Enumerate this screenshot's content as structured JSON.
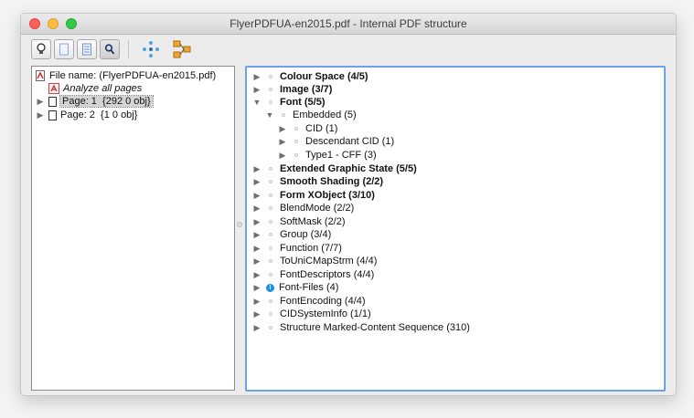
{
  "window": {
    "title": "FlyerPDFUA-en2015.pdf - Internal PDF structure"
  },
  "toolbar": {
    "buttons": [
      {
        "icon": "lightbulb-icon"
      },
      {
        "icon": "page-icon"
      },
      {
        "icon": "page-layout-icon"
      },
      {
        "icon": "magnifier-icon"
      },
      {
        "icon": "structure-nodes-icon"
      },
      {
        "icon": "tag-tree-icon"
      }
    ]
  },
  "left_tree": {
    "file_name": "File name: (FlyerPDFUA-en2015.pdf)",
    "analyze": "Analyze all pages",
    "pages": [
      {
        "label": "Page: 1",
        "obj": "{292 0 obj}"
      },
      {
        "label": "Page: 2",
        "obj": "{1 0 obj}"
      }
    ]
  },
  "right_tree": {
    "items": [
      {
        "label": "Colour Space (4/5)"
      },
      {
        "label": "Image (3/7)"
      },
      {
        "label": "Font (5/5)"
      },
      {
        "label": "Embedded (5)"
      },
      {
        "label": "CID (1)"
      },
      {
        "label": "Descendant CID (1)"
      },
      {
        "label": "Type1 - CFF (3)"
      },
      {
        "label": "Extended Graphic State (5/5)"
      },
      {
        "label": "Smooth Shading (2/2)"
      },
      {
        "label": "Form XObject (3/10)"
      },
      {
        "label": "BlendMode (2/2)"
      },
      {
        "label": "SoftMask (2/2)"
      },
      {
        "label": "Group (3/4)"
      },
      {
        "label": "Function (7/7)"
      },
      {
        "label": "ToUniCMapStrm (4/4)"
      },
      {
        "label": "FontDescriptors (4/4)"
      },
      {
        "label": "Font-Files (4)"
      },
      {
        "label": "FontEncoding (4/4)"
      },
      {
        "label": "CIDSystemInfo (1/1)"
      },
      {
        "label": "Structure Marked-Content Sequence (310)"
      }
    ]
  },
  "colors": {
    "selection_border": "#6ca3e6",
    "info_badge": "#1c8fe6"
  }
}
